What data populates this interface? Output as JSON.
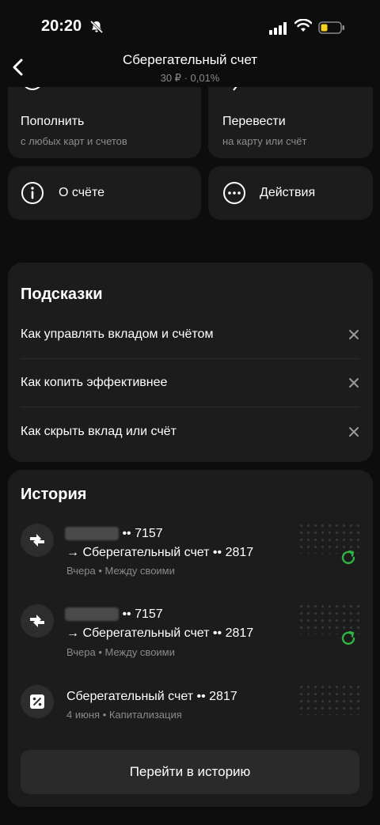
{
  "status": {
    "time": "20:20"
  },
  "header": {
    "title": "Сберегательный счет",
    "subtitle": "30 ₽ · 0,01%"
  },
  "actions": {
    "top_up": {
      "title": "Пополнить",
      "sub": "с любых карт и счетов"
    },
    "transfer": {
      "title": "Перевести",
      "sub": "на карту или счёт"
    },
    "about": {
      "title": "О счёте"
    },
    "more": {
      "title": "Действия"
    }
  },
  "tips": {
    "title": "Подсказки",
    "items": [
      "Как управлять вкладом и счётом",
      "Как копить эффективнее",
      "Как скрыть вклад или счёт"
    ]
  },
  "history": {
    "title": "История",
    "items": [
      {
        "from_suffix": "•• 7157",
        "to": "→ Сберегательный счет •• 2817",
        "meta": "Вчера • Между своими"
      },
      {
        "from_suffix": "•• 7157",
        "to": "→ Сберегательный счет •• 2817",
        "meta": "Вчера • Между своими"
      },
      {
        "title": "Сберегательный счет •• 2817",
        "meta": "4 июня • Капитализация"
      }
    ],
    "button": "Перейти в историю"
  },
  "colors": {
    "background": "#0d0d0d",
    "card": "#1c1c1c",
    "accent_green": "#2fb344"
  }
}
